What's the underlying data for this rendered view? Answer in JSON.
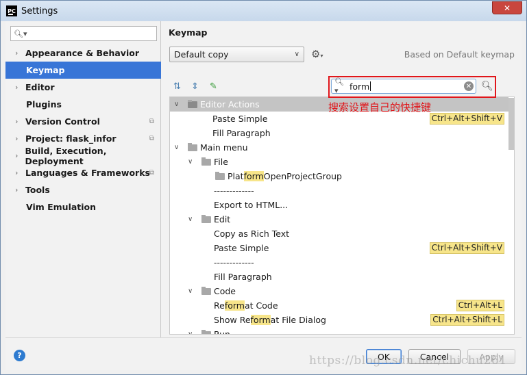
{
  "window": {
    "title": "Settings",
    "app_icon": "PC",
    "close_icon": "close-icon"
  },
  "sidebar": {
    "search_placeholder": "",
    "items": [
      {
        "label": "Appearance & Behavior",
        "expandable": true
      },
      {
        "label": "Keymap",
        "selected": true
      },
      {
        "label": "Editor",
        "expandable": true
      },
      {
        "label": "Plugins"
      },
      {
        "label": "Version Control",
        "expandable": true,
        "project_icon": true
      },
      {
        "label": "Project: flask_infor",
        "expandable": true,
        "project_icon": true
      },
      {
        "label": "Build, Execution, Deployment",
        "expandable": true
      },
      {
        "label": "Languages & Frameworks",
        "expandable": true,
        "project_icon": true
      },
      {
        "label": "Tools",
        "expandable": true
      },
      {
        "label": "Vim Emulation"
      }
    ]
  },
  "keymap": {
    "header": "Keymap",
    "scheme": "Default copy",
    "based_on": "Based on Default keymap",
    "search_value": "form",
    "annotation": "搜索设置自己的快捷键"
  },
  "tree": [
    {
      "pre": "Editor Actions",
      "hit": "",
      "post": "",
      "shortcut": "",
      "level": 0,
      "type": "group",
      "header": true
    },
    {
      "pre": "Paste Simple",
      "hit": "",
      "post": "",
      "shortcut": "Ctrl+Alt+Shift+V",
      "level": 2,
      "type": "action"
    },
    {
      "pre": "Fill Paragraph",
      "hit": "",
      "post": "",
      "shortcut": "",
      "level": 2,
      "type": "action"
    },
    {
      "pre": "Main menu",
      "hit": "",
      "post": "",
      "shortcut": "",
      "level": 0,
      "type": "group"
    },
    {
      "pre": "File",
      "hit": "",
      "post": "",
      "shortcut": "",
      "level": 1,
      "type": "folder"
    },
    {
      "pre": "Plat",
      "hit": "form",
      "post": "OpenProjectGroup",
      "shortcut": "",
      "level": 2,
      "type": "leaf-folder"
    },
    {
      "pre": "-------------",
      "hit": "",
      "post": "",
      "shortcut": "",
      "level": 3,
      "type": "action"
    },
    {
      "pre": "Export to HTML...",
      "hit": "",
      "post": "",
      "shortcut": "",
      "level": 3,
      "type": "action"
    },
    {
      "pre": "Edit",
      "hit": "",
      "post": "",
      "shortcut": "",
      "level": 1,
      "type": "folder"
    },
    {
      "pre": "Copy as Rich Text",
      "hit": "",
      "post": "",
      "shortcut": "",
      "level": 3,
      "type": "action"
    },
    {
      "pre": "Paste Simple",
      "hit": "",
      "post": "",
      "shortcut": "Ctrl+Alt+Shift+V",
      "level": 3,
      "type": "action"
    },
    {
      "pre": "-------------",
      "hit": "",
      "post": "",
      "shortcut": "",
      "level": 3,
      "type": "action"
    },
    {
      "pre": "Fill Paragraph",
      "hit": "",
      "post": "",
      "shortcut": "",
      "level": 3,
      "type": "action"
    },
    {
      "pre": "Code",
      "hit": "",
      "post": "",
      "shortcut": "",
      "level": 1,
      "type": "folder"
    },
    {
      "pre": "Re",
      "hit": "form",
      "post": "at Code",
      "shortcut": "Ctrl+Alt+L",
      "level": 3,
      "type": "action"
    },
    {
      "pre": "Show Re",
      "hit": "form",
      "post": "at File Dialog",
      "shortcut": "Ctrl+Alt+Shift+L",
      "level": 3,
      "type": "action"
    },
    {
      "pre": "Run",
      "hit": "",
      "post": "",
      "shortcut": "",
      "level": 1,
      "type": "folder"
    }
  ],
  "buttons": {
    "ok": "OK",
    "cancel": "Cancel",
    "apply": "Apply",
    "help": "?"
  },
  "watermark": "https://blog.csdn.net/chichu261"
}
